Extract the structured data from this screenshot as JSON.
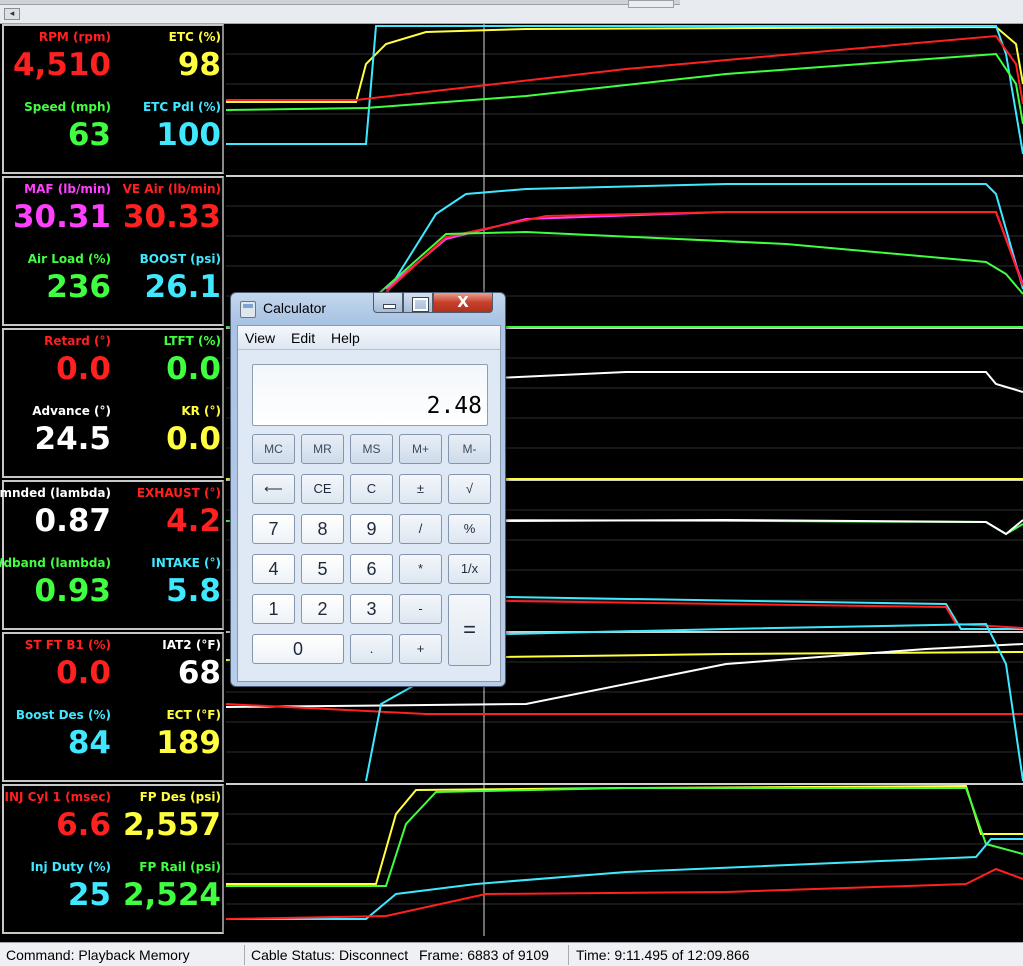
{
  "gauge_groups": [
    {
      "cells": [
        {
          "label": "RPM (rpm)",
          "value": "4,510",
          "label_color": "#ff2020",
          "value_color": "#ff2020"
        },
        {
          "label": "ETC (%)",
          "value": "98",
          "label_color": "#ffff40",
          "value_color": "#ffff40"
        },
        {
          "label": "Speed (mph)",
          "value": "63",
          "label_color": "#40ff40",
          "value_color": "#40ff40"
        },
        {
          "label": "ETC Pdl (%)",
          "value": "100",
          "label_color": "#40e8ff",
          "value_color": "#40e8ff"
        }
      ]
    },
    {
      "cells": [
        {
          "label": "MAF (lb/min)",
          "value": "30.31",
          "label_color": "#ff40ff",
          "value_color": "#ff40ff"
        },
        {
          "label": "VE Air (lb/min)",
          "value": "30.33",
          "label_color": "#ff2020",
          "value_color": "#ff2020"
        },
        {
          "label": "Air Load (%)",
          "value": "236",
          "label_color": "#40ff40",
          "value_color": "#40ff40"
        },
        {
          "label": "BOOST (psi)",
          "value": "26.1",
          "label_color": "#40e8ff",
          "value_color": "#40e8ff"
        }
      ]
    },
    {
      "cells": [
        {
          "label": "Retard (°)",
          "value": "0.0",
          "label_color": "#ff2020",
          "value_color": "#ff2020"
        },
        {
          "label": "LTFT (%)",
          "value": "0.0",
          "label_color": "#40ff40",
          "value_color": "#40ff40"
        },
        {
          "label": "Advance (°)",
          "value": "24.5",
          "label_color": "#ffffff",
          "value_color": "#ffffff"
        },
        {
          "label": "KR (°)",
          "value": "0.0",
          "label_color": "#ffff40",
          "value_color": "#ffff40"
        }
      ]
    },
    {
      "cells": [
        {
          "label": "Cmnded (lambda)",
          "value": "0.87",
          "label_color": "#ffffff",
          "value_color": "#ffffff"
        },
        {
          "label": "EXHAUST (°)",
          "value": "4.2",
          "label_color": "#ff2020",
          "value_color": "#ff2020"
        },
        {
          "label": "Wdband (lambda)",
          "value": "0.93",
          "label_color": "#40ff40",
          "value_color": "#40ff40"
        },
        {
          "label": "INTAKE (°)",
          "value": "5.8",
          "label_color": "#40e8ff",
          "value_color": "#40e8ff"
        }
      ]
    },
    {
      "cells": [
        {
          "label": "ST FT B1 (%)",
          "value": "0.0",
          "label_color": "#ff2020",
          "value_color": "#ff2020"
        },
        {
          "label": "IAT2 (°F)",
          "value": "68",
          "label_color": "#ffffff",
          "value_color": "#ffffff"
        },
        {
          "label": "Boost Des (%)",
          "value": "84",
          "label_color": "#40e8ff",
          "value_color": "#40e8ff"
        },
        {
          "label": "ECT (°F)",
          "value": "189",
          "label_color": "#ffff40",
          "value_color": "#ffff40"
        }
      ]
    },
    {
      "cells": [
        {
          "label": "INJ Cyl 1 (msec)",
          "value": "6.6",
          "label_color": "#ff2020",
          "value_color": "#ff2020"
        },
        {
          "label": "FP Des (psi)",
          "value": "2,557",
          "label_color": "#ffff40",
          "value_color": "#ffff40"
        },
        {
          "label": "Inj Duty (%)",
          "value": "25",
          "label_color": "#40e8ff",
          "value_color": "#40e8ff"
        },
        {
          "label": "FP Rail (psi)",
          "value": "2,524",
          "label_color": "#40ff40",
          "value_color": "#40ff40"
        }
      ]
    }
  ],
  "status_bar": {
    "command": "Command:  Playback Memory",
    "cable": "Cable Status:  Disconnect",
    "frame": "Frame:  6883 of 9109",
    "time": "Time:  9:11.495 of 12:09.866"
  },
  "calculator": {
    "title": "Calculator",
    "close_glyph": "X",
    "menu": [
      "View",
      "Edit",
      "Help"
    ],
    "display": "2.48",
    "memory_keys": [
      "MC",
      "MR",
      "MS",
      "M+",
      "M-"
    ],
    "row2": [
      "⟵",
      "CE",
      "C",
      "±",
      "√"
    ],
    "row3": [
      "7",
      "8",
      "9",
      "/",
      "%"
    ],
    "row4": [
      "4",
      "5",
      "6",
      "*",
      "1/x"
    ],
    "row5": [
      "1",
      "2",
      "3",
      "-"
    ],
    "row6": [
      "0",
      ".",
      "+"
    ],
    "equals": "="
  },
  "colors": {
    "red": "#ff2020",
    "yellow": "#ffff40",
    "green": "#40ff40",
    "cyan": "#40e8ff",
    "magenta": "#ff40ff",
    "white": "#ffffff"
  }
}
